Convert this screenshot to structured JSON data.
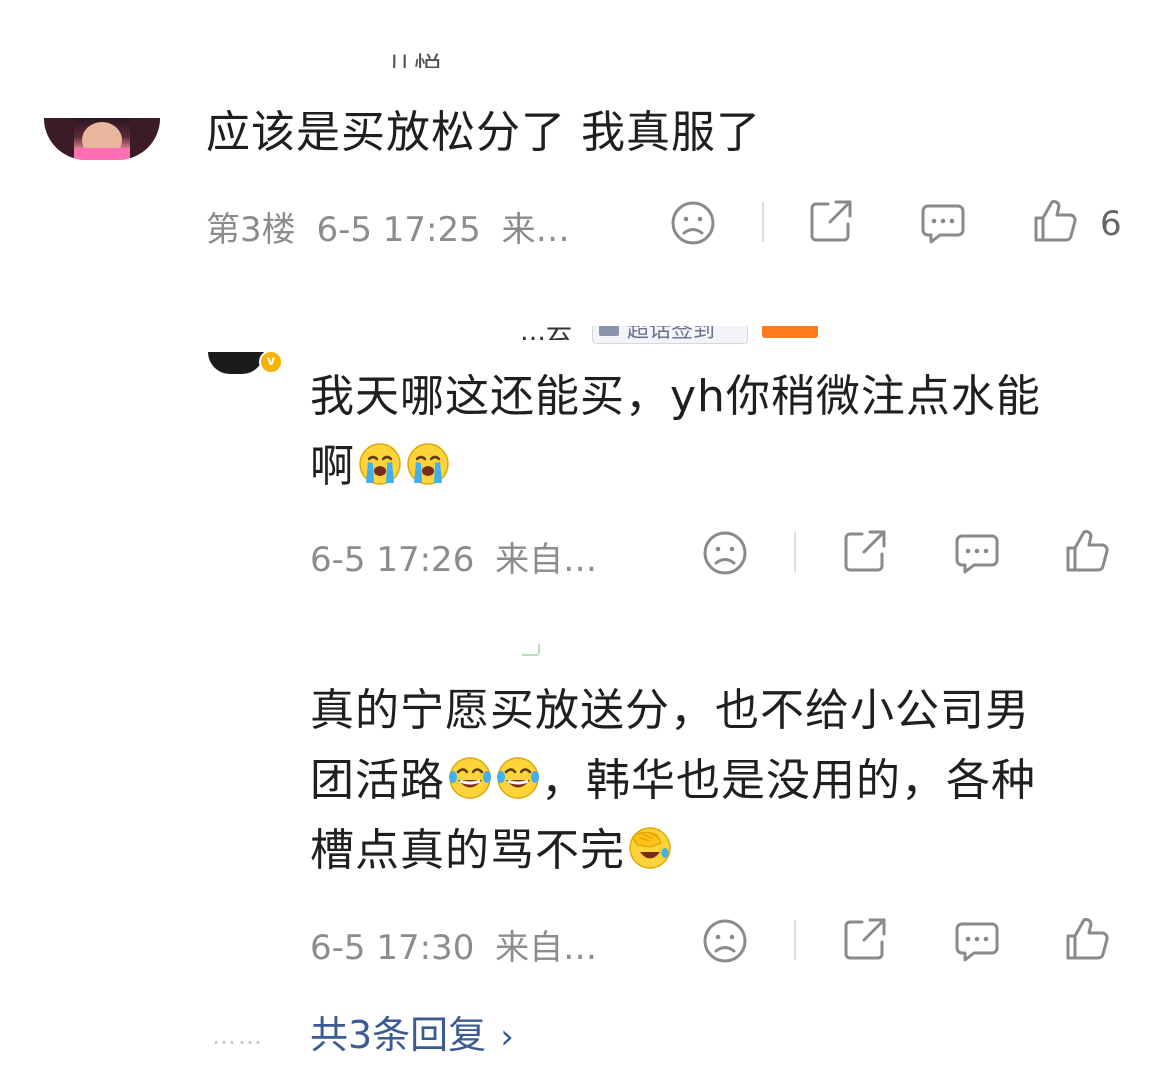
{
  "comments": [
    {
      "cropped_name": "儿悦",
      "text": "应该是买放松分了 我真服了",
      "floor": "第3楼",
      "time": "6-5 17:25",
      "source": "来…",
      "like_count": "6"
    }
  ],
  "replies": [
    {
      "cropped_name_fragment": "…云",
      "tag_label": "超话签到",
      "text": "我天哪这还能买，yh你稍微注点水能啊",
      "text_line1": "我天哪这还能买，yh你稍微注点水能",
      "text_line2": "啊",
      "time": "6-5 17:26",
      "source": "来自…"
    },
    {
      "text": "真的宁愿买放送分，也不给小公司男团活路，韩华也是没用的，各种槽点真的骂不完",
      "text_line1": "真的宁愿买放送分，也不给小公司男",
      "text_line2a": "团活路",
      "text_line2b": "，韩华也是没用的，各种",
      "text_line3": "槽点真的骂不完",
      "time": "6-5 17:30",
      "source": "来自…"
    }
  ],
  "more": {
    "dots": "……",
    "label": "共3条回复",
    "chevron": "›"
  },
  "badge": {
    "letter": "v",
    "color": "#f6b400"
  },
  "icons": [
    "sad-face-icon",
    "share-icon",
    "comment-icon",
    "like-thumb-icon"
  ],
  "colors": {
    "meta_text": "#8c8c8c",
    "link": "#3b5b92",
    "icon_stroke": "#8a8a8a"
  }
}
